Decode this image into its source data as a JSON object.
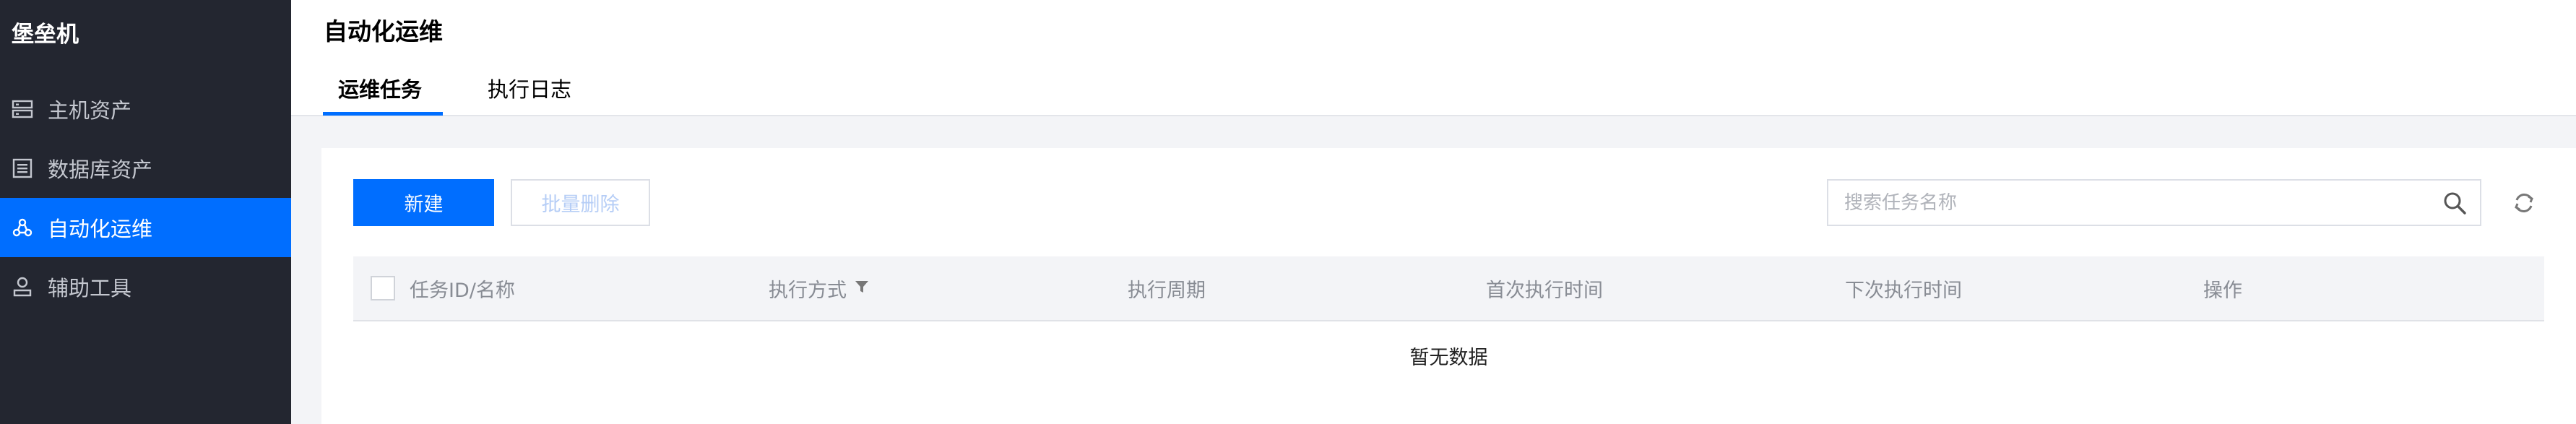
{
  "sidebar": {
    "title": "堡垒机",
    "items": [
      {
        "label": "主机资产",
        "icon": "server-icon"
      },
      {
        "label": "数据库资产",
        "icon": "database-icon"
      },
      {
        "label": "自动化运维",
        "icon": "automation-icon",
        "active": true
      },
      {
        "label": "辅助工具",
        "icon": "tool-icon"
      }
    ],
    "bg_color": "#232630",
    "active_color": "#006eff"
  },
  "header": {
    "title": "自动化运维",
    "tabs": [
      {
        "label": "运维任务",
        "active": true
      },
      {
        "label": "执行日志"
      }
    ]
  },
  "toolbar": {
    "new_label": "新建",
    "batch_delete_label": "批量删除",
    "search_placeholder": "搜索任务名称"
  },
  "table": {
    "columns": [
      "任务ID/名称",
      "执行方式",
      "执行周期",
      "首次执行时间",
      "下次执行时间",
      "操作"
    ],
    "empty_text": "暂无数据"
  },
  "colors": {
    "accent": "#006eff",
    "page_bg": "#f3f4f7"
  }
}
